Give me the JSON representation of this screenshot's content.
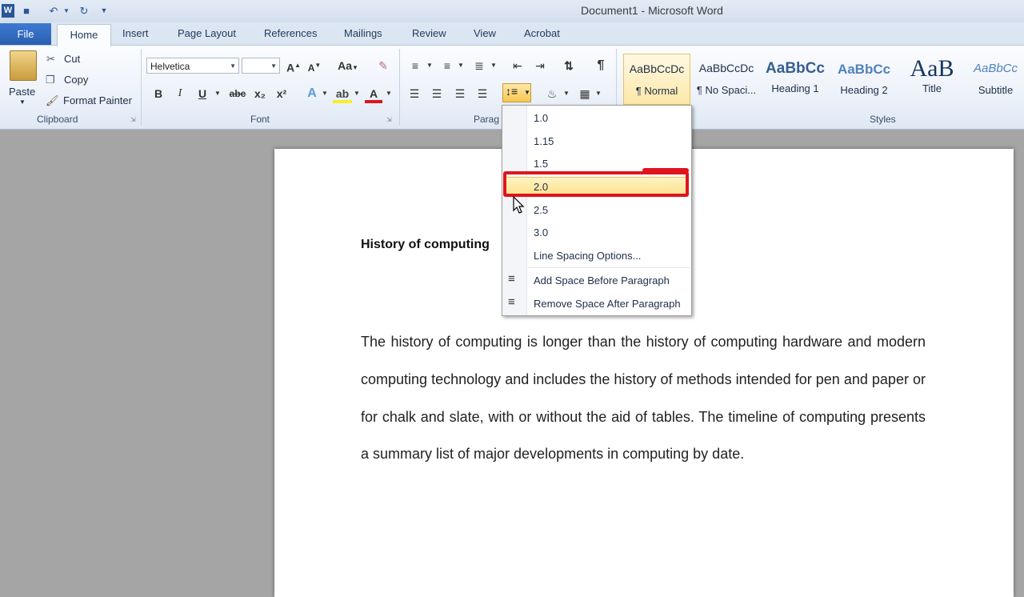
{
  "window": {
    "title": "Document1 - Microsoft Word"
  },
  "tabs": {
    "file": "File",
    "home": "Home",
    "insert": "Insert",
    "page_layout": "Page Layout",
    "references": "References",
    "mailings": "Mailings",
    "review": "Review",
    "view": "View",
    "acrobat": "Acrobat"
  },
  "clipboard": {
    "paste": "Paste",
    "cut": "Cut",
    "copy": "Copy",
    "format_painter": "Format Painter",
    "label": "Clipboard"
  },
  "font": {
    "name": "Helvetica",
    "size": "",
    "label": "Font",
    "bold": "B",
    "italic": "I",
    "underline": "U",
    "subscript": "x₂",
    "superscript": "x²"
  },
  "paragraph": {
    "label": "Parag"
  },
  "styles": {
    "label": "Styles",
    "items": [
      {
        "sample": "AaBbCcDc",
        "name": "¶ Normal"
      },
      {
        "sample": "AaBbCcDc",
        "name": "¶ No Spaci..."
      },
      {
        "sample": "AaBbCc",
        "name": "Heading 1"
      },
      {
        "sample": "AaBbCc",
        "name": "Heading 2"
      },
      {
        "sample": "AaB",
        "name": "Title"
      },
      {
        "sample": "AaBbCc",
        "name": "Subtitle"
      }
    ]
  },
  "line_spacing_menu": {
    "options": [
      "1.0",
      "1.15",
      "1.5",
      "2.0",
      "2.5",
      "3.0"
    ],
    "selected": "2.0",
    "options_link": "Line Spacing Options...",
    "add_space_before": "Add Space Before Paragraph",
    "remove_space_after": "Remove Space After Paragraph"
  },
  "document": {
    "heading": "History of computing",
    "body": "The history of computing is longer than the history of computing hardware and modern computing technology and includes the history of methods intended for pen and paper or for chalk and slate, with or without the aid of tables. The timeline of computing presents a summary list of major developments in computing by date."
  },
  "icons": {
    "word": "word-app-icon",
    "save": "save-icon",
    "undo": "undo-icon",
    "redo": "redo-icon",
    "bullets": "bullets-icon",
    "numbering": "numbering-icon",
    "multilevel": "multilevel-list-icon",
    "line_spacing": "line-spacing-icon",
    "shading": "shading-icon",
    "borders": "borders-icon",
    "sort": "sort-icon",
    "pilcrow": "show-formatting-icon"
  },
  "colors": {
    "accent": "#2a5fae",
    "highlight": "#fde28b",
    "annotation": "#e0141d"
  }
}
